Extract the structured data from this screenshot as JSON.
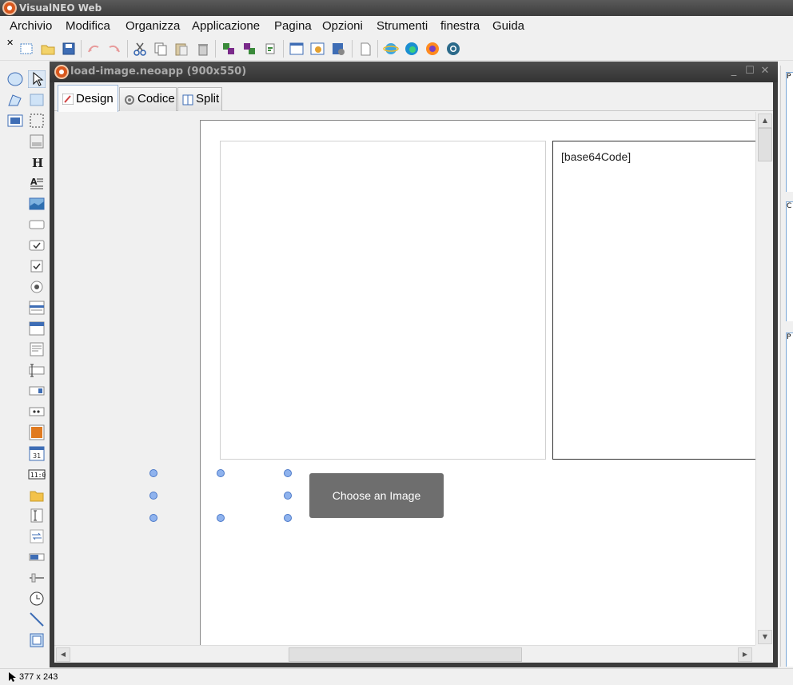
{
  "app": {
    "title": "VisualNEO Web"
  },
  "menu": [
    "Archivio",
    "Modifica",
    "Organizza",
    "Applicazione",
    "Pagina",
    "Opzioni",
    "Strumenti",
    "finestra",
    "Guida"
  ],
  "document": {
    "title": "load-image.neoapp (900x550)",
    "tabs": {
      "design": "Design",
      "code": "Codice",
      "split": "Split"
    }
  },
  "canvas": {
    "text_box_content": "[base64Code]",
    "button_label": "Choose an Image"
  },
  "status": {
    "selection_size": "377 x 243"
  },
  "right_panel": {
    "label_1": "P",
    "label_2": "C",
    "label_3": "P"
  },
  "colors": {
    "accent_logo": "#d8581e",
    "handle": "#8fb3ee",
    "button_bg": "#6e6e6e"
  }
}
